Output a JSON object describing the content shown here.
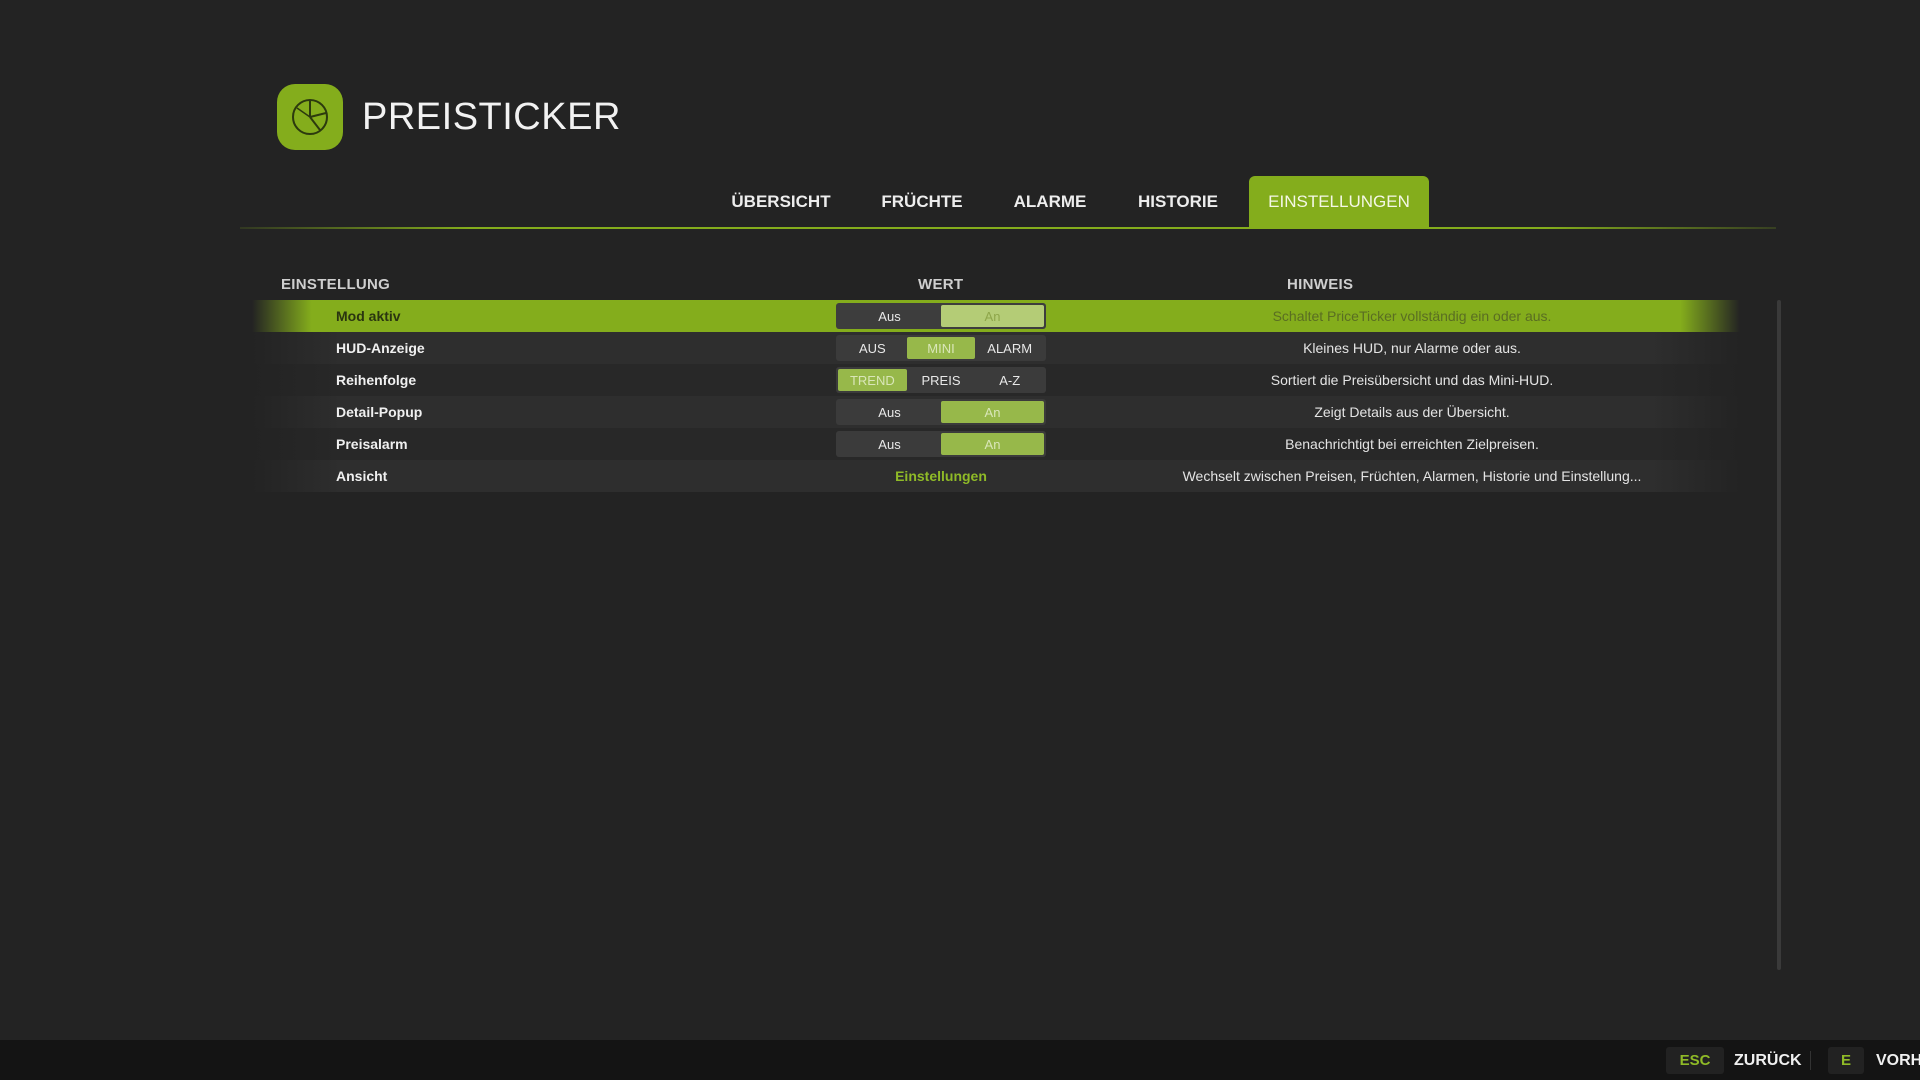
{
  "app": {
    "title": "PREISTICKER",
    "logo_icon": "pie-chart-icon",
    "accent_color": "#84ad1c"
  },
  "tabs": [
    {
      "label": "ÜBERSICHT",
      "active": false
    },
    {
      "label": "FRÜCHTE",
      "active": false
    },
    {
      "label": "ALARME",
      "active": false
    },
    {
      "label": "HISTORIE",
      "active": false
    },
    {
      "label": "EINSTELLUNGEN",
      "active": true
    }
  ],
  "columns": {
    "setting": "EINSTELLUNG",
    "value": "WERT",
    "hint": "HINWEIS"
  },
  "rows": [
    {
      "label": "Mod aktiv",
      "options": [
        "Aus",
        "An"
      ],
      "selected": "An",
      "hint": "Schaltet PriceTicker vollständig ein oder aus."
    },
    {
      "label": "HUD-Anzeige",
      "options": [
        "AUS",
        "MINI",
        "ALARM"
      ],
      "selected": "MINI",
      "hint": "Kleines HUD, nur Alarme oder aus."
    },
    {
      "label": "Reihenfolge",
      "options": [
        "TREND",
        "PREIS",
        "A-Z"
      ],
      "selected": "TREND",
      "hint": "Sortiert die Preisübersicht und das Mini-HUD."
    },
    {
      "label": "Detail-Popup",
      "options": [
        "Aus",
        "An"
      ],
      "selected": "An",
      "hint": "Zeigt Details aus der Übersicht."
    },
    {
      "label": "Preisalarm",
      "options": [
        "Aus",
        "An"
      ],
      "selected": "An",
      "hint": "Benachrichtigt bei erreichten Zielpreisen."
    },
    {
      "label": "Ansicht",
      "link": "Einstellungen",
      "hint": "Wechselt zwischen Preisen, Früchten, Alarmen, Historie und Einstellung..."
    }
  ],
  "footer": {
    "back_key": "ESC",
    "back_label": "ZURÜCK",
    "prev_key": "E",
    "prev_label": "VORH"
  }
}
